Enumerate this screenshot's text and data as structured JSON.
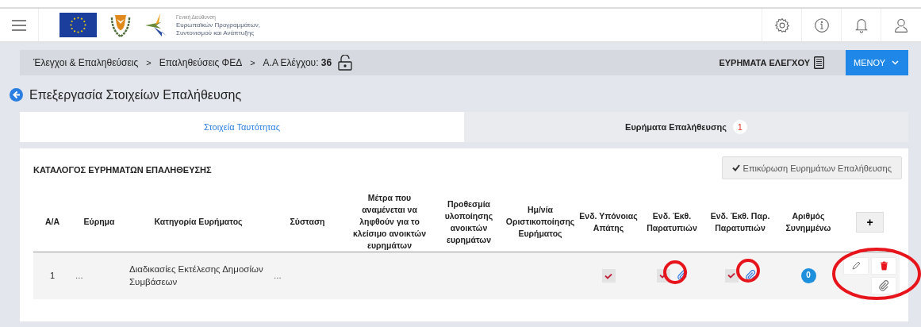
{
  "header": {
    "logo_text": [
      "Γενική Διεύθυνση",
      "Ευρωπαϊκών Προγραμμάτων,",
      "Συντονισμού και Ανάπτυξης"
    ]
  },
  "breadcrumb": {
    "separator": ">",
    "items": [
      "Έλεγχοι & Επαληθεύσεις",
      "Επαληθεύσεις ΦΕΔ",
      "Α.Α Ελέγχου: **36**"
    ],
    "findings_link": "ΕΥΡΗΜΑΤΑ ΕΛΕΓΧΟΥ",
    "menu_button": "ΜΕΝΟΥ"
  },
  "page_title": "Επεξεργασία Στοιχείων Επαλήθευσης",
  "tabs": [
    {
      "label": "Στοιχεία Ταυτότητας",
      "selected": false
    },
    {
      "label": "Ευρήματα Επαλήθευσης",
      "selected": true,
      "badge": "1"
    }
  ],
  "panel": {
    "title": "ΚΑΤΑΛΟΓΟΣ ΕΥΡΗΜΑΤΩΝ ΕΠΑΛΗΘΕΥΣΗΣ",
    "confirm_button": "Επικύρωση Ευρημάτων Επαλήθευσης",
    "table": {
      "columns": [
        "Α/Α",
        "Εύρημα",
        "Κατηγορία Ευρήματος",
        "Σύσταση",
        "Μέτρα που αναμένεται να ληφθούν για το κλείσιμο ανοικτών ευρημάτων",
        "Προθεσμία υλοποίησης ανοικτών ευρημάτων",
        "Ημ/νία Οριστικοποίησης Ευρήματος",
        "Ενδ. Υπόνοιας Απάτης",
        "Ενδ. Έκθ. Παρατυπιών",
        "Ενδ. Έκθ. Παρ. Παρατυπιών",
        "Αριθμός Συνημμένω"
      ],
      "add_button": "+",
      "rows": [
        {
          "cells": [
            {
              "kind": "text",
              "text": "1"
            },
            {
              "kind": "text",
              "text": "..."
            },
            {
              "kind": "text",
              "text": "Διαδικασίες Εκτέλεσης Δημοσίων Συμβάσεων"
            },
            {
              "kind": "text",
              "text": "..."
            },
            {
              "kind": "empty"
            },
            {
              "kind": "empty"
            },
            {
              "kind": "empty"
            },
            {
              "kind": "check",
              "checked": true
            },
            {
              "kind": "check_clip",
              "checked": true
            },
            {
              "kind": "check_clip",
              "checked": true
            },
            {
              "kind": "badge",
              "text": "0"
            },
            {
              "kind": "actions"
            }
          ]
        }
      ]
    }
  }
}
